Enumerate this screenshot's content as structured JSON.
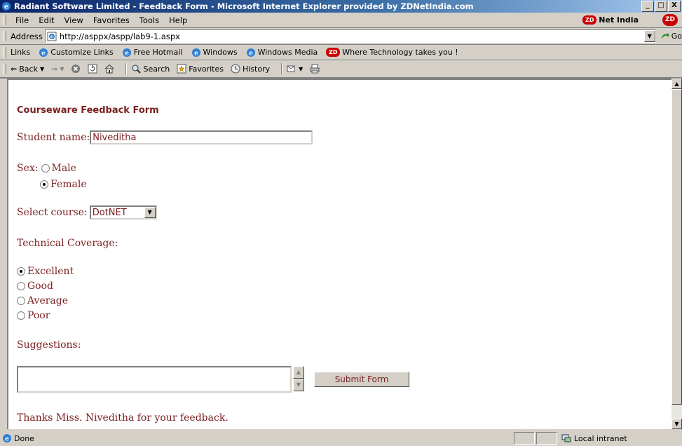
{
  "window": {
    "title": "Radiant Software Limited - Feedback Form - Microsoft Internet Explorer provided by ZDNetIndia.com",
    "buttons": [
      "_",
      "□",
      "X"
    ]
  },
  "menu": {
    "items": [
      "File",
      "Edit",
      "View",
      "Favorites",
      "Tools",
      "Help"
    ],
    "brand": "Net India",
    "brand_badge": "ZD"
  },
  "address": {
    "label": "Address",
    "url": "http://asppx/aspp/lab9-1.aspx",
    "go_label": "Go"
  },
  "links": {
    "label": "Links",
    "items": [
      "Customize Links",
      "Free Hotmail",
      "Windows",
      "Windows Media",
      "Where Technology takes you !"
    ]
  },
  "toolbar": {
    "back": "Back",
    "search": "Search",
    "favorites": "Favorites",
    "history": "History"
  },
  "form": {
    "title": "Courseware Feedback Form",
    "student_label": "Student name:",
    "student_value": "Niveditha",
    "sex_label": "Sex:",
    "sex_options": [
      "Male",
      "Female"
    ],
    "sex_selected": "Female",
    "course_label": "Select course:",
    "course_value": "DotNET",
    "coverage_label": "Technical Coverage:",
    "coverage_options": [
      "Excellent",
      "Good",
      "Average",
      "Poor"
    ],
    "coverage_selected": "Excellent",
    "suggestions_label": "Suggestions:",
    "submit_label": "Submit Form",
    "thanks_message": "Thanks Miss. Niveditha for your feedback."
  },
  "status": {
    "text": "Done",
    "zone": "Local intranet"
  },
  "colors": {
    "titlebar_start": "#0a246a",
    "titlebar_end": "#a6caf0",
    "form_text": "#7b1f1f",
    "chrome": "#d4d0c8"
  }
}
